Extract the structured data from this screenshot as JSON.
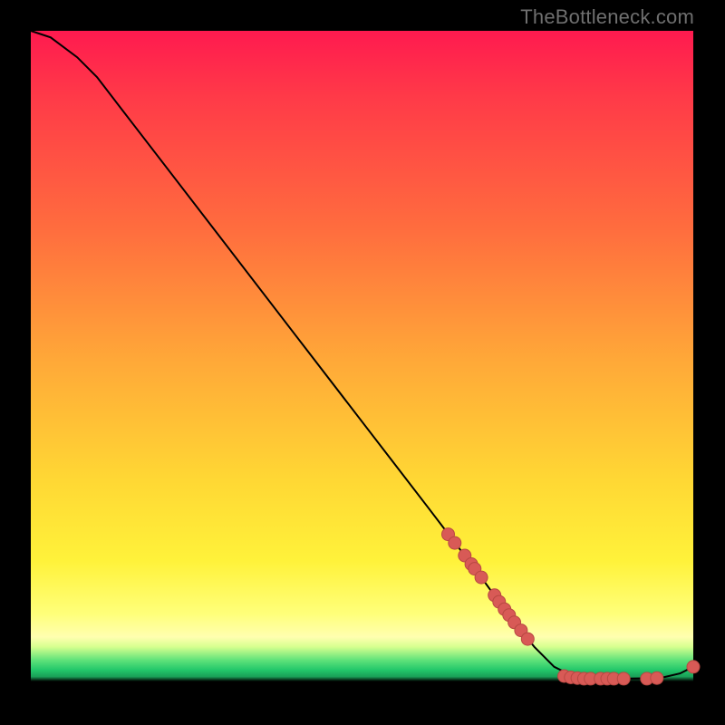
{
  "attribution": "TheBottleneck.com",
  "colors": {
    "marker_fill": "#d85a56",
    "marker_stroke": "#b84842",
    "curve_stroke": "#000000"
  },
  "chart_data": {
    "type": "line",
    "title": "",
    "xlabel": "",
    "ylabel": "",
    "xlim": [
      0,
      100
    ],
    "ylim": [
      0,
      100
    ],
    "curve": [
      {
        "x": 0,
        "y": 100
      },
      {
        "x": 3,
        "y": 99
      },
      {
        "x": 7,
        "y": 96
      },
      {
        "x": 10,
        "y": 93
      },
      {
        "x": 15,
        "y": 86.5
      },
      {
        "x": 20,
        "y": 80
      },
      {
        "x": 30,
        "y": 67
      },
      {
        "x": 40,
        "y": 54
      },
      {
        "x": 50,
        "y": 41
      },
      {
        "x": 60,
        "y": 28
      },
      {
        "x": 68,
        "y": 17.5
      },
      {
        "x": 72,
        "y": 12
      },
      {
        "x": 76,
        "y": 7
      },
      {
        "x": 79,
        "y": 4
      },
      {
        "x": 82,
        "y": 2.5
      },
      {
        "x": 85,
        "y": 2.2
      },
      {
        "x": 90,
        "y": 2.2
      },
      {
        "x": 95,
        "y": 2.3
      },
      {
        "x": 98,
        "y": 3
      },
      {
        "x": 100,
        "y": 4
      }
    ],
    "markers": [
      {
        "x": 63,
        "y": 24
      },
      {
        "x": 64,
        "y": 22.7
      },
      {
        "x": 65.5,
        "y": 20.8
      },
      {
        "x": 66.5,
        "y": 19.5
      },
      {
        "x": 67.0,
        "y": 18.8
      },
      {
        "x": 68,
        "y": 17.5
      },
      {
        "x": 70,
        "y": 14.8
      },
      {
        "x": 70.7,
        "y": 13.8
      },
      {
        "x": 71.5,
        "y": 12.7
      },
      {
        "x": 72.2,
        "y": 11.8
      },
      {
        "x": 73,
        "y": 10.7
      },
      {
        "x": 74,
        "y": 9.5
      },
      {
        "x": 75,
        "y": 8.2
      },
      {
        "x": 80.5,
        "y": 2.6
      },
      {
        "x": 81.5,
        "y": 2.4
      },
      {
        "x": 82.5,
        "y": 2.3
      },
      {
        "x": 83.5,
        "y": 2.2
      },
      {
        "x": 84.5,
        "y": 2.2
      },
      {
        "x": 86,
        "y": 2.2
      },
      {
        "x": 87,
        "y": 2.2
      },
      {
        "x": 88,
        "y": 2.2
      },
      {
        "x": 89.5,
        "y": 2.2
      },
      {
        "x": 93,
        "y": 2.2
      },
      {
        "x": 94.5,
        "y": 2.3
      },
      {
        "x": 100,
        "y": 4
      }
    ]
  }
}
